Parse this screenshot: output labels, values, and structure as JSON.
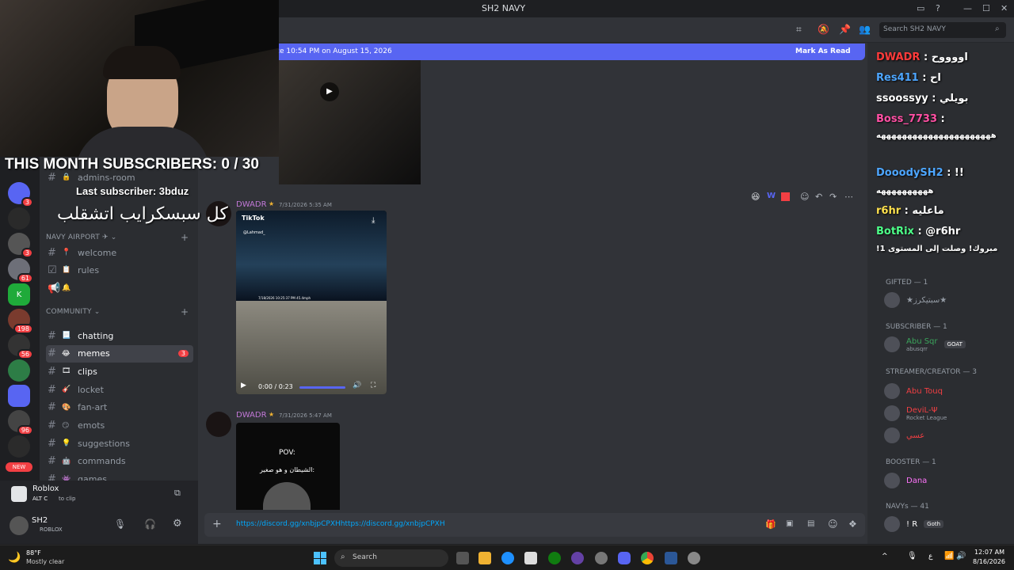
{
  "window": {
    "title": "SH2 NAVY"
  },
  "header": {
    "search_placeholder": "Search SH2 NAVY"
  },
  "banner": {
    "text": "ce 10:54 PM on August 15, 2026",
    "action": "Mark As Read"
  },
  "stream": {
    "subs_line": "THIS MONTH SUBSCRIBERS: 0 / 30",
    "last_sub": "Last subscriber: 3bduz",
    "arabic_line": "كل سبسكرايب اتشقلب"
  },
  "servers": {
    "badges": [
      "3",
      "3",
      "61",
      "198",
      "56",
      "96"
    ],
    "new_label": "NEW"
  },
  "channels": {
    "top": [
      {
        "name": "admins-room"
      }
    ],
    "navy_category": "NAVY AIRPORT ✈",
    "navy": [
      {
        "name": "welcome",
        "emoji": "📍"
      },
      {
        "name": "rules",
        "emoji": "📋"
      }
    ],
    "community_category": "COMMUNITY",
    "community": [
      {
        "name": "chatting",
        "emoji": "📃",
        "state": "unread"
      },
      {
        "name": "memes",
        "emoji": "😂",
        "state": "active",
        "count": "3"
      },
      {
        "name": "clips",
        "emoji": "🎞",
        "state": "unread"
      },
      {
        "name": "locket",
        "emoji": "🎸",
        "state": ""
      },
      {
        "name": "fan-art",
        "emoji": "🎨",
        "state": ""
      },
      {
        "name": "emots",
        "emoji": "😏",
        "state": ""
      },
      {
        "name": "suggestions",
        "emoji": "💡",
        "state": ""
      },
      {
        "name": "commands",
        "emoji": "🤖",
        "state": ""
      },
      {
        "name": "games",
        "emoji": "👾",
        "state": ""
      }
    ]
  },
  "activity": {
    "game": "Roblox",
    "hint_keys": "ALT  C",
    "hint": "to clip"
  },
  "user": {
    "name": "SH2",
    "status": "ROBLOX"
  },
  "messages": [
    {
      "author": "DWADR",
      "time": "7/31/2026 5:35 AM",
      "tiktok": "TikTok",
      "tiktok_user": "@Lahmad_",
      "video_time": "0:00 / 0:23",
      "video_stamp": "7/18/2026 10:25:37 PM  45.4mph"
    },
    {
      "author": "DWADR",
      "time": "7/31/2026 5:47 AM",
      "pov": "POV:",
      "pov_caption": "الشيطان و هو صغير:"
    }
  ],
  "composer": {
    "value": "https://discord.gg/xnbjpCPXHhttps://discord.gg/xnbjpCPXH"
  },
  "stream_chat": [
    {
      "user": "DWADR",
      "text": ": اووووح",
      "color": "#ff3b3b"
    },
    {
      "user": "Res411",
      "text": ": اح",
      "color": "#4da6ff"
    },
    {
      "user": "ssoossyy",
      "text": ": بويلي",
      "color": "#ffffff"
    },
    {
      "user": "Boss_7733",
      "text": ":",
      "color": "#ff4fa3"
    },
    {
      "user": "",
      "text": "ههههههههههههههههههههههه",
      "color": "#ffffff"
    },
    {
      "user": "DooodySH2",
      "text": ": !!",
      "color": "#4da6ff"
    },
    {
      "user": "",
      "text": "ههههههههههه",
      "color": "#ffffff"
    },
    {
      "user": "r6hr",
      "text": ": ماعليه",
      "color": "#ffe14d"
    },
    {
      "user": "BotRix",
      "text": ": @r6hr",
      "color": "#4dff88"
    },
    {
      "user": "",
      "text": "!مبروك! وصلت إلى المستوى 1",
      "color": "#ffffff"
    }
  ],
  "members": {
    "groups": [
      {
        "title": "GIFTED — 1",
        "items": [
          {
            "name": "★سبتيكرز★",
            "color": "#949ba4",
            "sub": ""
          }
        ]
      },
      {
        "title": "SUBSCRIBER — 1",
        "items": [
          {
            "name": "Abu Sqr",
            "color": "#3ba55c",
            "sub": "abusqrr",
            "tag": "GOAT"
          }
        ]
      },
      {
        "title": "STREAMER/CREATOR — 3",
        "items": [
          {
            "name": "Abu Touq",
            "color": "#f23f43",
            "sub": ""
          },
          {
            "name": "DeviL-Ψ",
            "color": "#f23f43",
            "sub": "Rocket League"
          },
          {
            "name": "عسي",
            "color": "#f23f43",
            "sub": ""
          }
        ]
      },
      {
        "title": "BOOSTER — 1",
        "items": [
          {
            "name": "Dana",
            "color": "#ff73fa",
            "sub": ""
          }
        ]
      },
      {
        "title": "NAVYs — 41",
        "items": [
          {
            "name": "! R",
            "color": "#ffffff",
            "sub": "",
            "tag": "Goth"
          }
        ]
      }
    ]
  },
  "taskbar": {
    "weather_temp": "88°F",
    "weather_text": "Mostly clear",
    "search": "Search",
    "time": "12:07 AM",
    "date": "8/16/2026"
  }
}
